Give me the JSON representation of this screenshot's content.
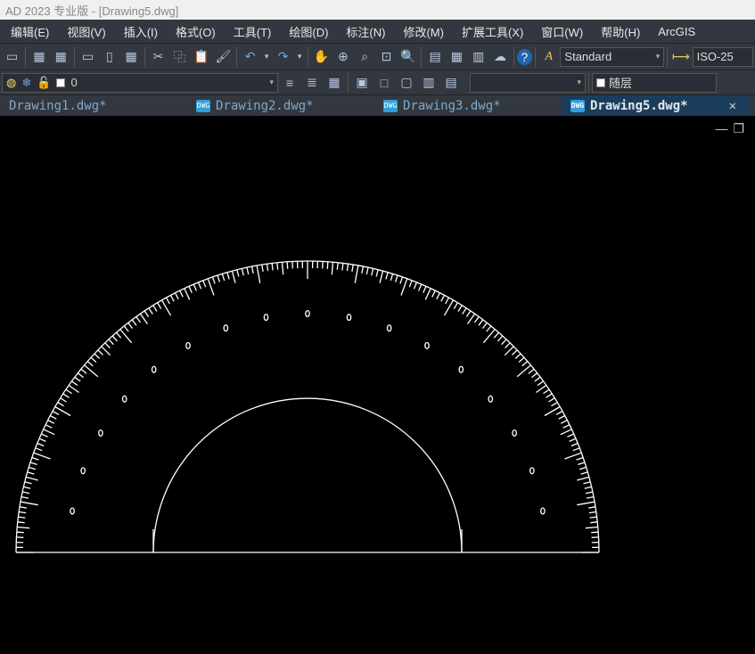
{
  "title": "AD 2023 专业版 - [Drawing5.dwg]",
  "menus": {
    "edit": "编辑(E)",
    "view": "视图(V)",
    "insert": "插入(I)",
    "format": "格式(O)",
    "tools": "工具(T)",
    "draw": "绘图(D)",
    "dim": "标注(N)",
    "modify": "修改(M)",
    "ext": "扩展工具(X)",
    "window": "窗口(W)",
    "help": "帮助(H)",
    "arcgis": "ArcGIS"
  },
  "textstyle": {
    "value": "Standard"
  },
  "dimstyle": {
    "value": "ISO-25"
  },
  "layer": {
    "value": "0"
  },
  "bylayer": {
    "value": "随层"
  },
  "tabs": {
    "t1": "Drawing1.dwg*",
    "t2": "Drawing2.dwg*",
    "t3": "Drawing3.dwg*",
    "t5": "Drawing5.dwg*"
  },
  "icons": {
    "new": "🗋",
    "open": "📂",
    "save": "💾",
    "cut": "✂",
    "copy": "⿻",
    "paste": "📋",
    "undo": "↶",
    "redo": "↷",
    "pan": "✋",
    "zoomext": "🔍",
    "zoomwin": "⌕",
    "props": "▤",
    "table": "▦",
    "sheet": "▥",
    "help": "?",
    "text": "A",
    "dim": "⟷"
  }
}
